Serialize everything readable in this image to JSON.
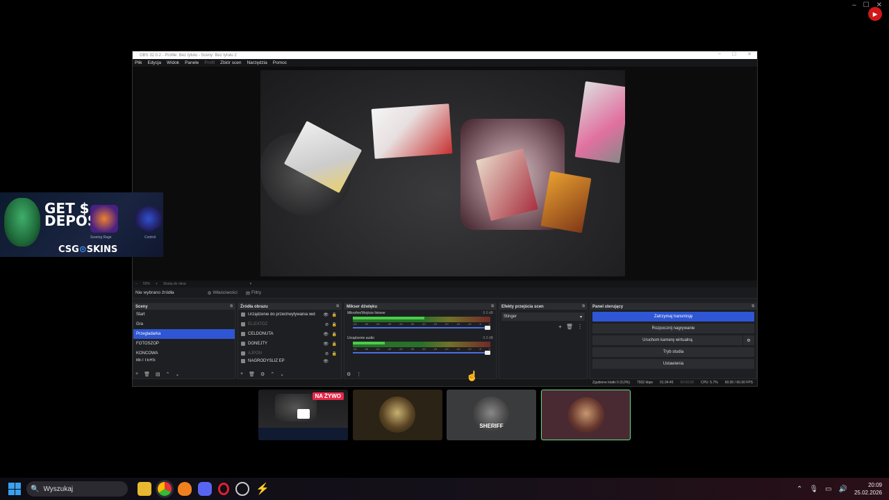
{
  "obs": {
    "title": "OBS 32.0.2 - Profile: Bez tytułu - Sceny: Bez tytułu 2",
    "menu": [
      "Plik",
      "Edycja",
      "Widok",
      "Panele",
      "Profil",
      "Zbiór scen",
      "Narzędzia",
      "Pomoc"
    ],
    "preview_toolbar": {
      "zoom": "55%",
      "fit": "Skaluj do okna"
    },
    "source_bar": {
      "none_selected": "Nie wybrano źródła",
      "properties": "Właściwości",
      "filters": "Filtry"
    },
    "scenes": {
      "title": "Sceny",
      "items": [
        "Start",
        "Gra",
        "Przegladarka",
        "FOTOSZOP",
        "KONCOWA",
        "BETTERS"
      ],
      "selected": "Przegladarka"
    },
    "sources": {
      "title": "Źródła obrazu",
      "items": [
        {
          "name": "Urządzenie do przechwytywania wid",
          "visible": true
        },
        {
          "name": "ELIZATOZ",
          "visible": false
        },
        {
          "name": "CELDONUTA",
          "visible": true
        },
        {
          "name": "DONEJTY",
          "visible": true
        },
        {
          "name": "AJPON",
          "visible": false
        },
        {
          "name": "NAGRODYSLIZ EP",
          "visible": true
        }
      ]
    },
    "mixer": {
      "title": "Mikser dźwięku",
      "channels": [
        {
          "name": "Mikrofon/Wejście liniowe",
          "db": "0.0 dB",
          "level": 0.52
        },
        {
          "name": "Urządzenie audio",
          "db": "0.0 dB",
          "level": 0.23
        }
      ],
      "scale": [
        "-60",
        "-55",
        "-50",
        "-45",
        "-40",
        "-35",
        "-30",
        "-25",
        "-20",
        "-15",
        "-10",
        "-5",
        "0"
      ]
    },
    "transitions": {
      "title": "Efekty przejścia scen",
      "selected": "Stinger"
    },
    "controls": {
      "title": "Panel sterujący",
      "buttons": [
        "Zatrzymaj transmisję",
        "Rozpocznij nagrywanie",
        "Uruchom kamerę wirtualną",
        "Tryb studia",
        "Ustawienia"
      ]
    },
    "status": {
      "dropped": "Zgubione klatki 0 (0,0%)",
      "bitrate": "7932 kbps",
      "live_time": "01:34:46",
      "rec_time": "00:00:00",
      "cpu": "CPU: 5.7%",
      "fps": "60.00 / 60.00 FPS"
    }
  },
  "ad": {
    "headline": "GET $",
    "headline2": "DEPOS",
    "brand": "CSG",
    "brand2": "SKINS",
    "item1": "Searing Rage",
    "item2": "Control"
  },
  "participants": {
    "live_badge": "NA ŻYWO",
    "sheriff": "SHERIFF"
  },
  "taskbar": {
    "search": "Wyszukaj",
    "time": "20:09",
    "date": "25.02.2026"
  },
  "colors": {
    "accent": "#2f56d4",
    "live": "#e8284a",
    "selected_tile_border": "#5fe08a"
  }
}
